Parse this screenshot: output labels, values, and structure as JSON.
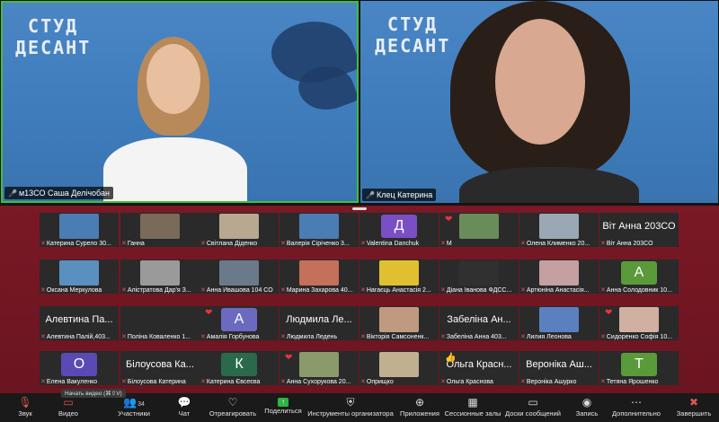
{
  "speakers": {
    "left": {
      "name": "м13СО Саша Делічобан",
      "logo_line1": "СТУД",
      "logo_line2": "ДЕСАНТ"
    },
    "right": {
      "name": "Клец Катерина",
      "logo_line1": "СТУД",
      "logo_line2": "ДЕСАНТ"
    }
  },
  "gallery": [
    {
      "label": "Катерина Сурело 30...",
      "kind": "video",
      "color": "#4a7db4",
      "muted": true
    },
    {
      "label": "Ганна",
      "kind": "video",
      "color": "#7a6a5a",
      "muted": true
    },
    {
      "label": "Світлана Діденко",
      "kind": "video",
      "color": "#b8a890",
      "muted": true
    },
    {
      "label": "Валерія Сіріченко 3...",
      "kind": "video",
      "color": "#4a7db4",
      "muted": true
    },
    {
      "label": "Valentina Danchuk",
      "kind": "avatar",
      "letter": "Д",
      "color": "#7b4fc4",
      "muted": true
    },
    {
      "label": "М",
      "kind": "video",
      "color": "#6a8c5a",
      "muted": true,
      "heart": true
    },
    {
      "label": "Олена Клименко 20...",
      "kind": "video",
      "color": "#9aa8b4",
      "muted": true
    },
    {
      "label": "Віт Анна 203СО",
      "big": "Віт Анна 203СО",
      "kind": "name",
      "muted": true
    },
    {
      "label": "Оксана Меркулова",
      "kind": "video",
      "color": "#5a8fc0",
      "muted": true
    },
    {
      "label": "Алістратова Дар'я З...",
      "kind": "video",
      "color": "#9a9a9a",
      "muted": true
    },
    {
      "label": "Анна Ивашова 104 СО",
      "kind": "video",
      "color": "#6a7a8a",
      "muted": true
    },
    {
      "label": "Марина Захарова 40...",
      "kind": "video",
      "color": "#c4705a",
      "muted": true
    },
    {
      "label": "Нагаєць Анастасія 2...",
      "kind": "video",
      "color": "#e0c030",
      "muted": true
    },
    {
      "label": "Діана Іванова ФДСС...",
      "kind": "video",
      "color": "#303030",
      "muted": true
    },
    {
      "label": "Артюніна Анастасія...",
      "kind": "video",
      "color": "#c4a0a0",
      "muted": true
    },
    {
      "label": "Анна Солодовник 10...",
      "kind": "avatar",
      "letter": "А",
      "color": "#5a9a3a",
      "muted": true
    },
    {
      "label": "Алевтина Палій,403...",
      "big": "Алевтина Па...",
      "kind": "name",
      "muted": true
    },
    {
      "label": "Поліна Коваленко 1...",
      "kind": "video",
      "color": "#2a2a2a",
      "muted": true
    },
    {
      "label": "Амалія Горбунова",
      "kind": "avatar",
      "letter": "А",
      "color": "#6a6ac0",
      "muted": true,
      "heart": true
    },
    {
      "label": "Людмила Ледень",
      "big": "Людмила Ле...",
      "kind": "name",
      "muted": true
    },
    {
      "label": "Вікторія Самсоненк...",
      "kind": "video",
      "color": "#c09a80",
      "muted": true
    },
    {
      "label": "Забеліна Анна 403...",
      "big": "Забеліна Ан...",
      "kind": "name",
      "muted": true
    },
    {
      "label": "Лилия Леонова",
      "kind": "video",
      "color": "#5a80c0",
      "muted": true
    },
    {
      "label": "Сидоренко Софія 10...",
      "kind": "video",
      "color": "#d0b0a0",
      "muted": true,
      "heart": true
    },
    {
      "label": "Елена Вакуленко",
      "kind": "avatar",
      "letter": "О",
      "color": "#5a4ab4",
      "muted": true
    },
    {
      "label": "Білоусова Катерина",
      "big": "Білоусова Ка...",
      "kind": "name",
      "muted": true
    },
    {
      "label": "Катерина Євсеєва",
      "kind": "avatar",
      "letter": "К",
      "color": "#2a6a4a",
      "muted": true
    },
    {
      "label": "Анна Сухорукова 20...",
      "kind": "video",
      "color": "#8a9a6a",
      "muted": true,
      "heart": true
    },
    {
      "label": "Оприщко",
      "kind": "video",
      "color": "#c0b090",
      "muted": true
    },
    {
      "label": "Ольга Краснова",
      "big": "Ольга Красн...",
      "kind": "name",
      "muted": true,
      "thumb": true
    },
    {
      "label": "Вероніка Ашурко",
      "big": "Вероніка Аш...",
      "kind": "name",
      "muted": true
    },
    {
      "label": "Тетяна Ярошенко",
      "kind": "avatar",
      "letter": "Т",
      "color": "#5a9a3a",
      "muted": true
    }
  ],
  "toolbar": {
    "audio": "Звук",
    "video": "Видео",
    "participants": "Участники",
    "participants_count": "34",
    "chat": "Чат",
    "react": "Отреагировать",
    "share": "Поделиться",
    "host_tools": "Инструменты организатора",
    "apps": "Приложения",
    "breakout": "Сессионные залы",
    "whiteboards": "Доски сообщений",
    "record": "Запись",
    "more": "Дополнительно",
    "end": "Завершить"
  },
  "tooltip": "Начать видео (⌘⇧V)"
}
